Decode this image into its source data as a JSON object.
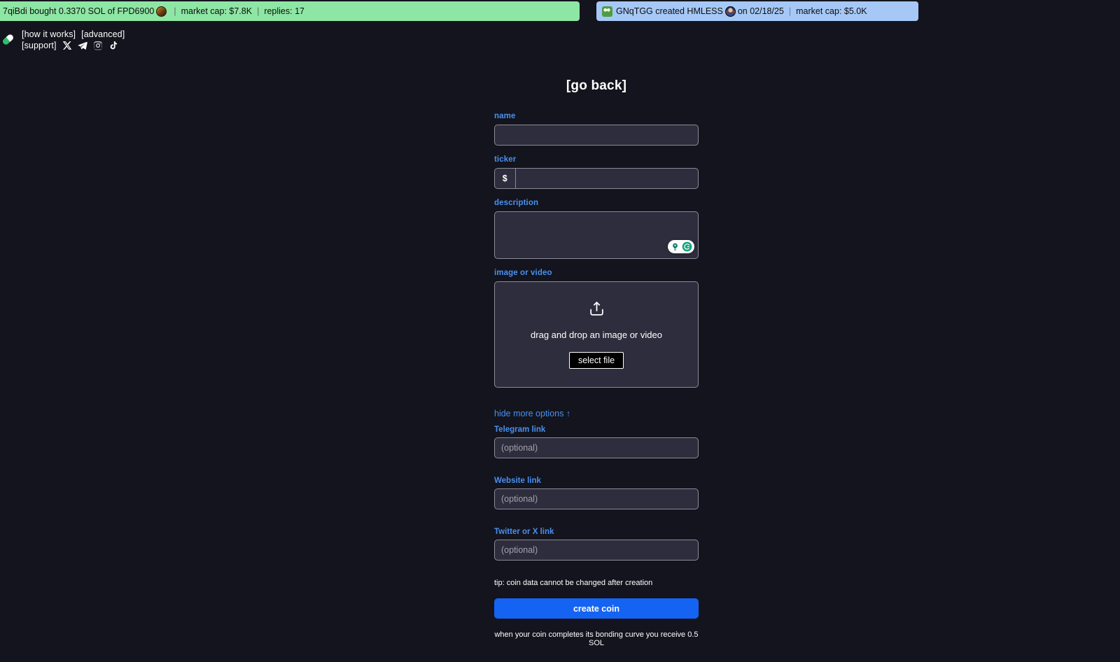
{
  "tickers": [
    {
      "id": "trade-ticker",
      "kind": "bought",
      "actor": "7qiBdi",
      "text_lead": "7qiBdi bought 0.3370 SOL of FPD6900",
      "avatar": "coin-avatar",
      "market_cap_label": "market cap: $7.8K",
      "replies_label": "replies: 17",
      "bg": "#8ee6a4"
    },
    {
      "id": "create-ticker",
      "kind": "created",
      "actor": "GNqTGG",
      "avatar": "frog-avatar",
      "text_lead": "GNqTGG created HMLESS",
      "text_tail": "on 02/18/25",
      "coin_avatar": "coin-avatar",
      "market_cap_label": "market cap: $5.0K",
      "bg": "#a5c8f7"
    }
  ],
  "nav": {
    "logo": "pill-logo",
    "links": [
      {
        "label": "[how it works]"
      },
      {
        "label": "[advanced]"
      },
      {
        "label": "[support]"
      }
    ],
    "socials": [
      {
        "name": "x-twitter-icon"
      },
      {
        "name": "telegram-icon"
      },
      {
        "name": "instagram-icon"
      },
      {
        "name": "tiktok-icon"
      }
    ]
  },
  "form": {
    "go_back": "[go back]",
    "name": {
      "label": "name",
      "value": "",
      "placeholder": ""
    },
    "ticker": {
      "label": "ticker",
      "prefix": "$",
      "value": "",
      "placeholder": ""
    },
    "description": {
      "label": "description",
      "value": "",
      "placeholder": ""
    },
    "grammarly": {
      "name": "grammarly-badge",
      "suggestion_icon": "lightbulb-icon",
      "logo_icon": "grammarly-g-icon"
    },
    "image_or_video": {
      "label": "image or video",
      "upload_icon": "upload-icon",
      "drop_text": "drag and drop an image or video",
      "select_button": "select file"
    },
    "more_options_toggle": "hide more options ↑",
    "optional_links": [
      {
        "label": "Telegram link",
        "value": "",
        "placeholder": "(optional)"
      },
      {
        "label": "Website link",
        "value": "",
        "placeholder": "(optional)"
      },
      {
        "label": "Twitter or X link",
        "value": "",
        "placeholder": "(optional)"
      }
    ],
    "tip": "tip: coin data cannot be changed after creation",
    "submit": "create coin",
    "bonding_note": "when your coin completes its bonding curve you receive 0.5 SOL"
  },
  "colors": {
    "page_bg": "#13141d",
    "accent_blue": "#4a90ef",
    "button_blue": "#1463f3",
    "input_bg": "#2d2d3d",
    "input_border": "#8b8b97",
    "ticker_green": "#8ee6a4",
    "ticker_blue": "#a5c8f7"
  }
}
